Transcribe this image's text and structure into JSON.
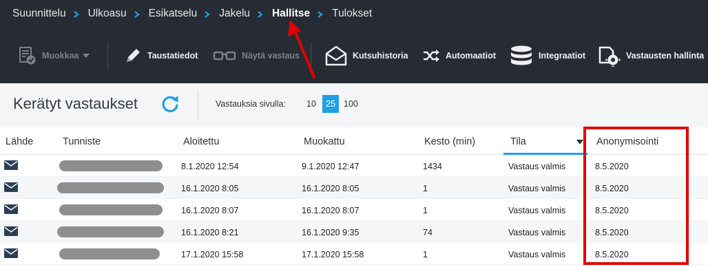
{
  "breadcrumb": [
    {
      "label": "Suunnittelu",
      "active": false
    },
    {
      "label": "Ulkoasu",
      "active": false
    },
    {
      "label": "Esikatselu",
      "active": false
    },
    {
      "label": "Jakelu",
      "active": false
    },
    {
      "label": "Hallitse",
      "active": true
    },
    {
      "label": "Tulokset",
      "active": false
    }
  ],
  "toolbar": {
    "edit_label": "Muokkaa",
    "background_label": "Taustatiedot",
    "show_answer_label": "Näytä vastaus",
    "invitation_history_label": "Kutsuhistoria",
    "automations_label": "Automaatiot",
    "integrations_label": "Integraatiot",
    "response_management_label": "Vastausten hallinta"
  },
  "controls": {
    "title": "Kerätyt vastaukset",
    "per_page_label": "Vastauksia sivulla:",
    "per_page_options": [
      "10",
      "25",
      "100"
    ],
    "per_page_selected": "25"
  },
  "table": {
    "columns": [
      "Lähde",
      "Tunniste",
      "Aloitettu",
      "Muokattu",
      "Kesto (min)",
      "Tila",
      "Anonymisointi"
    ],
    "sorted_column": "Tila",
    "rows": [
      {
        "source_icon": "envelope-icon",
        "id": "",
        "started": "8.1.2020 12:54",
        "modified": "9.1.2020 12:47",
        "duration": "1434",
        "status": "Vastaus valmis",
        "anonymization": "8.5.2020"
      },
      {
        "source_icon": "envelope-icon",
        "id": "",
        "started": "16.1.2020 8:05",
        "modified": "16.1.2020 8:05",
        "duration": "1",
        "status": "Vastaus valmis",
        "anonymization": "8.5.2020"
      },
      {
        "source_icon": "envelope-icon",
        "id": "",
        "started": "16.1.2020 8:07",
        "modified": "16.1.2020 8:07",
        "duration": "1",
        "status": "Vastaus valmis",
        "anonymization": "8.5.2020"
      },
      {
        "source_icon": "envelope-icon",
        "id": "",
        "started": "16.1.2020 8:21",
        "modified": "16.1.2020 9:35",
        "duration": "74",
        "status": "Vastaus valmis",
        "anonymization": "8.5.2020"
      },
      {
        "source_icon": "envelope-icon",
        "id": "",
        "started": "17.1.2020 15:58",
        "modified": "17.1.2020 15:58",
        "duration": "1",
        "status": "Vastaus valmis",
        "anonymization": "8.5.2020"
      }
    ]
  },
  "colors": {
    "topbar": "#262b34",
    "accent": "#1ea0e6",
    "annotation_red": "#e00000"
  }
}
